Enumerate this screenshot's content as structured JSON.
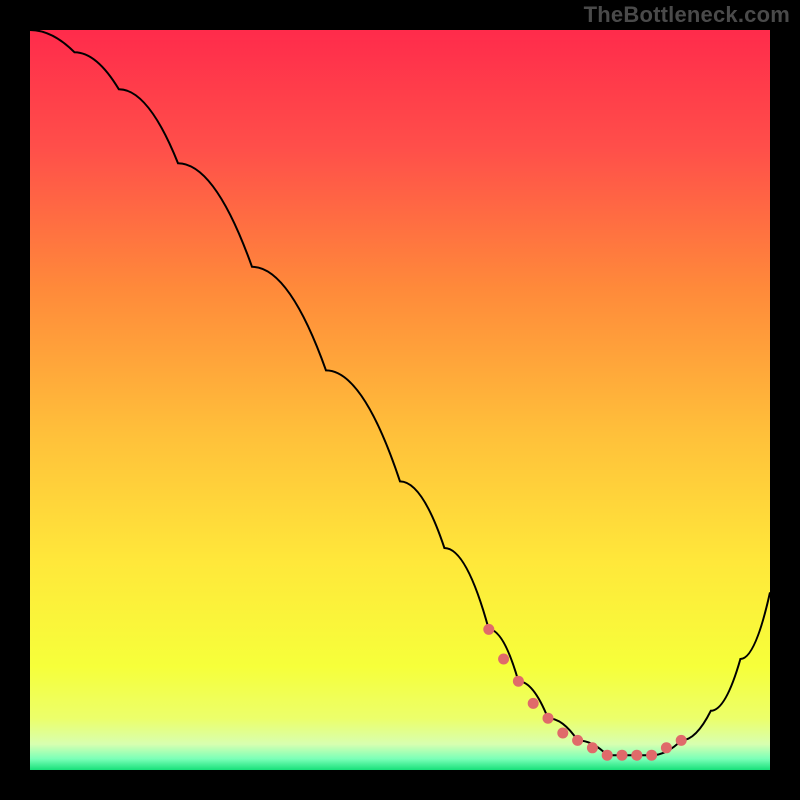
{
  "watermark": "TheBottleneck.com",
  "chart_data": {
    "type": "line",
    "title": "",
    "xlabel": "",
    "ylabel": "",
    "xlim": [
      0,
      100
    ],
    "ylim": [
      0,
      100
    ],
    "grid": false,
    "series": [
      {
        "name": "curve",
        "x": [
          0,
          6,
          12,
          20,
          30,
          40,
          50,
          56,
          62,
          66,
          70,
          74,
          78,
          80,
          84,
          88,
          92,
          96,
          100
        ],
        "values": [
          100,
          97,
          92,
          82,
          68,
          54,
          39,
          30,
          19,
          12,
          7,
          4,
          2,
          2,
          2,
          4,
          8,
          15,
          24
        ]
      }
    ],
    "flat_region": {
      "x": [
        62,
        64,
        66,
        68,
        70,
        72,
        74,
        76,
        78,
        80,
        82,
        84,
        86,
        88
      ],
      "values": [
        19,
        15,
        12,
        9,
        7,
        5,
        4,
        3,
        2,
        2,
        2,
        2,
        3,
        4
      ]
    },
    "gradient_stops": [
      {
        "offset": 0.0,
        "color": "#ff2b4b"
      },
      {
        "offset": 0.16,
        "color": "#ff4f4a"
      },
      {
        "offset": 0.35,
        "color": "#ff8a3a"
      },
      {
        "offset": 0.55,
        "color": "#ffc13a"
      },
      {
        "offset": 0.72,
        "color": "#ffe83a"
      },
      {
        "offset": 0.86,
        "color": "#f6ff3a"
      },
      {
        "offset": 0.93,
        "color": "#ecff6a"
      },
      {
        "offset": 0.965,
        "color": "#d8ffb0"
      },
      {
        "offset": 0.985,
        "color": "#7affb8"
      },
      {
        "offset": 1.0,
        "color": "#18e07a"
      }
    ],
    "dot_color": "#e06a6a",
    "curve_color": "#000000"
  }
}
